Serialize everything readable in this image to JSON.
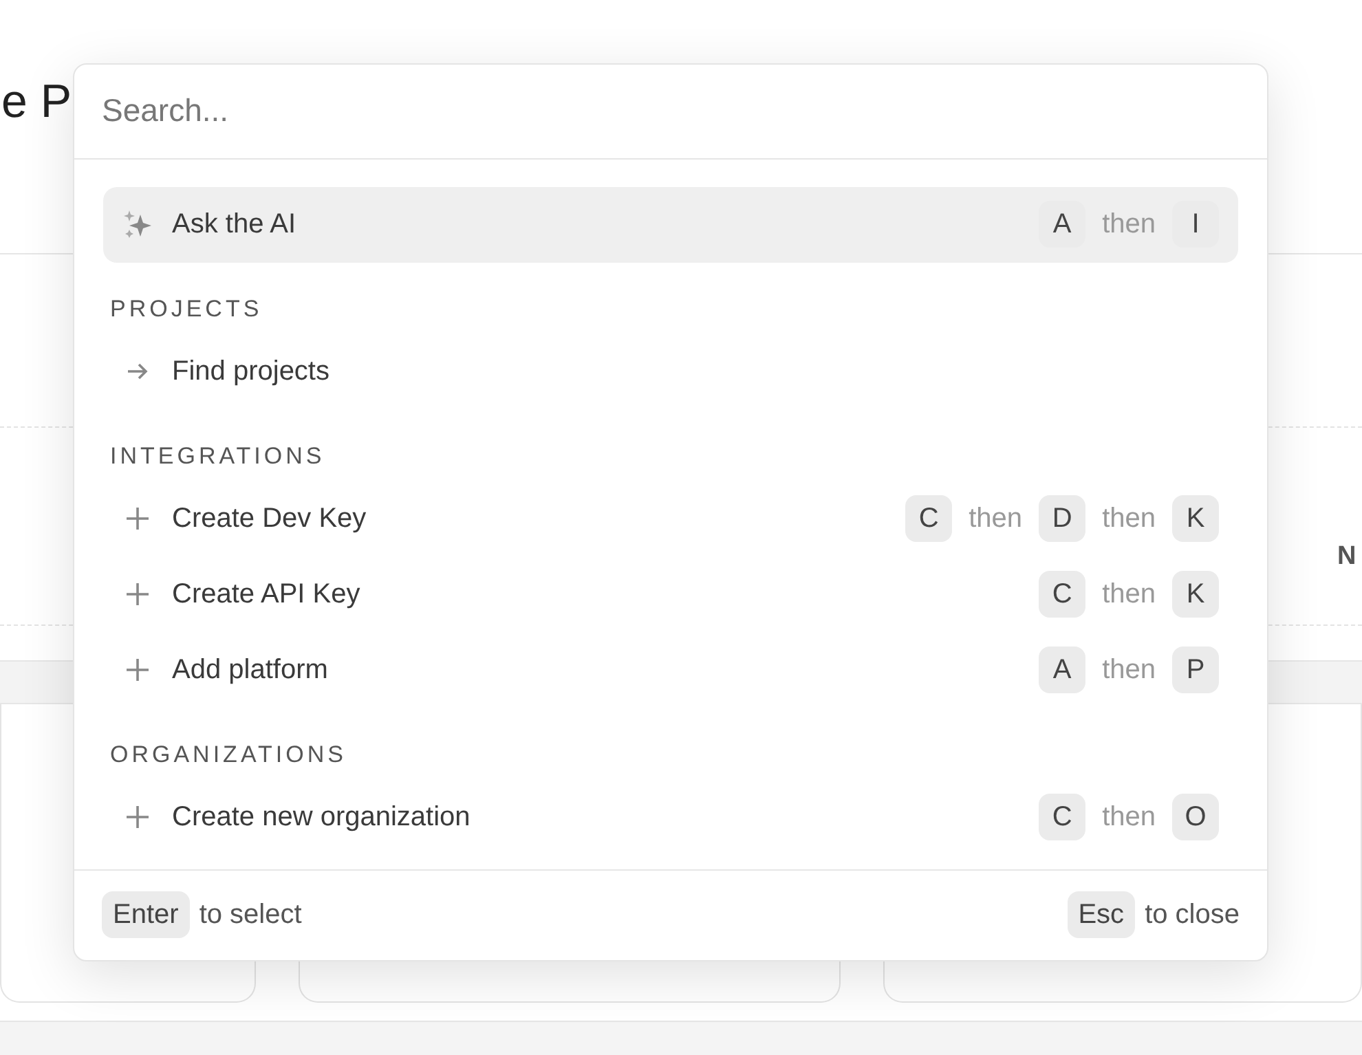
{
  "background": {
    "title": "e P",
    "side_label": "N"
  },
  "palette": {
    "search": {
      "placeholder": "Search..."
    },
    "groups": [
      {
        "items": [
          {
            "kind": "ai",
            "label": "Ask the AI",
            "selected": true,
            "shortcut": [
              {
                "kind": "key",
                "text": "A"
              },
              {
                "kind": "word",
                "text": "then"
              },
              {
                "kind": "key",
                "text": "I"
              }
            ]
          }
        ]
      },
      {
        "heading": "PROJECTS",
        "items": [
          {
            "kind": "arrow",
            "label": "Find projects",
            "selected": false
          }
        ]
      },
      {
        "heading": "INTEGRATIONS",
        "items": [
          {
            "kind": "plus",
            "label": "Create Dev Key",
            "selected": false,
            "shortcut": [
              {
                "kind": "key",
                "text": "C"
              },
              {
                "kind": "word",
                "text": "then"
              },
              {
                "kind": "key",
                "text": "D"
              },
              {
                "kind": "word",
                "text": "then"
              },
              {
                "kind": "key",
                "text": "K"
              }
            ]
          },
          {
            "kind": "plus",
            "label": "Create API Key",
            "selected": false,
            "shortcut": [
              {
                "kind": "key",
                "text": "C"
              },
              {
                "kind": "word",
                "text": "then"
              },
              {
                "kind": "key",
                "text": "K"
              }
            ]
          },
          {
            "kind": "plus",
            "label": "Add platform",
            "selected": false,
            "shortcut": [
              {
                "kind": "key",
                "text": "A"
              },
              {
                "kind": "word",
                "text": "then"
              },
              {
                "kind": "key",
                "text": "P"
              }
            ]
          }
        ]
      },
      {
        "heading": "ORGANIZATIONS",
        "items": [
          {
            "kind": "plus",
            "label": "Create new organization",
            "selected": false,
            "shortcut": [
              {
                "kind": "key",
                "text": "C"
              },
              {
                "kind": "word",
                "text": "then"
              },
              {
                "kind": "key",
                "text": "O"
              }
            ]
          }
        ]
      }
    ],
    "footer": {
      "left": {
        "key": "Enter",
        "text": "to select"
      },
      "right": {
        "key": "Esc",
        "text": "to close"
      }
    }
  }
}
